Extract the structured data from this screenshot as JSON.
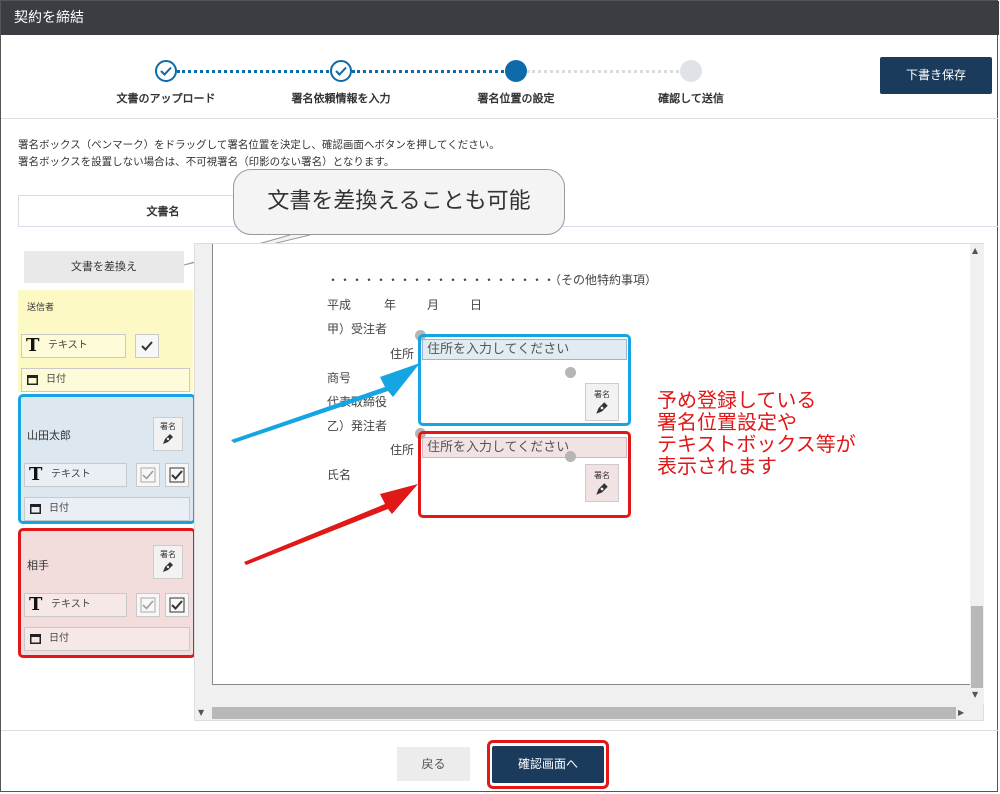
{
  "window": {
    "title": "契約を締結"
  },
  "steps": [
    {
      "label": "文書のアップロード",
      "state": "done"
    },
    {
      "label": "署名依頼情報を入力",
      "state": "done"
    },
    {
      "label": "署名位置の設定",
      "state": "current"
    },
    {
      "label": "確認して送信",
      "state": "todo"
    }
  ],
  "toolbar": {
    "draft_save": "下書き保存"
  },
  "instructions": {
    "line1": "署名ボックス（ペンマーク）をドラッグして署名位置を決定し、確認画面へボタンを押してください。",
    "line2": "署名ボックスを設置しない場合は、不可視署名（印影のない署名）となります。"
  },
  "tabs": {
    "doc_name": "文書名"
  },
  "callout": {
    "replace_note": "文書を差換えることも可能"
  },
  "sidebar": {
    "replace_button": "文書を差換え",
    "sender": {
      "label": "送信者",
      "text_field": "テキスト",
      "date_field": "日付"
    },
    "signer1": {
      "name": "山田太郎",
      "seal": "署名",
      "text_field": "テキスト",
      "date_field": "日付"
    },
    "signer2": {
      "name": "相手",
      "seal": "署名",
      "text_field": "テキスト",
      "date_field": "日付"
    }
  },
  "document": {
    "line_other": "・・・・・・・・・・・・・・・・・・・（その他特約事項）",
    "era": "平成",
    "year": "年",
    "month": "月",
    "day": "日",
    "contractor": "甲）受注者",
    "address_label1": "住所",
    "trade_name": "商号",
    "representative": "代表取締役",
    "orderer": "乙）発注者",
    "address_label2": "住所",
    "name_label": "氏名",
    "address_placeholder1": "住所を入力してください",
    "address_placeholder2": "住所を入力してください",
    "seal1": "署名",
    "seal2": "署名"
  },
  "annotation": {
    "line1": "予め登録している",
    "line2": "署名位置設定や",
    "line3": "テキストボックス等が",
    "line4": "表示されます"
  },
  "footer": {
    "back": "戻る",
    "confirm": "確認画面へ"
  },
  "colors": {
    "primary": "#1a3b5c",
    "step_blue": "#0e6aa8",
    "highlight_blue": "#14a5e2",
    "highlight_red": "#e01818",
    "sender_bg": "#fdf9c4"
  }
}
